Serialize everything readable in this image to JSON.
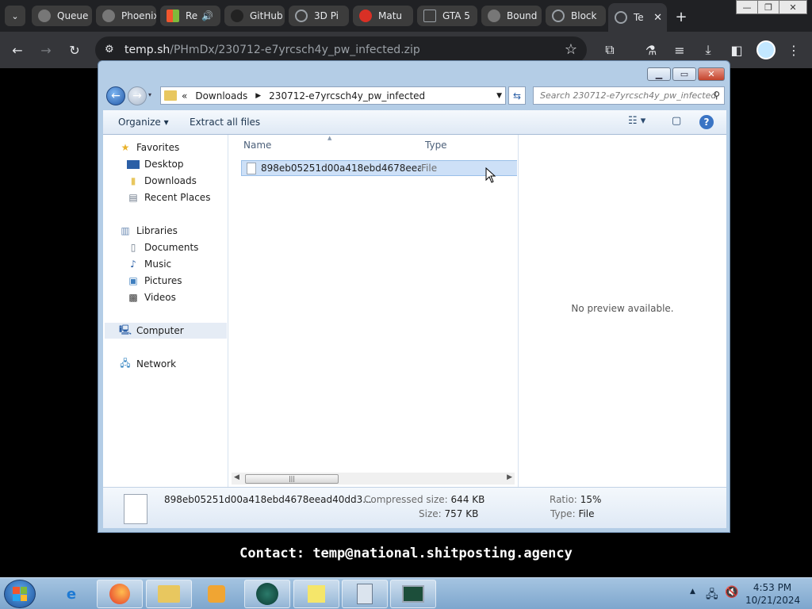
{
  "browser": {
    "tabs": [
      {
        "label": "Queue",
        "icon": "obs-icon",
        "color": "#777777"
      },
      {
        "label": "Phoenix",
        "icon": "obs-icon",
        "color": "#777777"
      },
      {
        "label": "Re",
        "icon": "windows-flag-icon",
        "color": "#f2572e",
        "audio": "speaker-icon"
      },
      {
        "label": "GitHub",
        "icon": "github-icon",
        "color": "#222222"
      },
      {
        "label": "3D Pi",
        "icon": "globe-icon",
        "color": "#9aa0a6"
      },
      {
        "label": "Matu",
        "icon": "red-logo-icon",
        "color": "#d93025"
      },
      {
        "label": "GTA 5",
        "icon": "gta-icon",
        "color": "#9aa0a6"
      },
      {
        "label": "Bound",
        "icon": "obs-icon",
        "color": "#777777"
      },
      {
        "label": "Block",
        "icon": "globe-icon",
        "color": "#9aa0a6"
      },
      {
        "label": "Te",
        "icon": "globe-icon",
        "color": "#9aa0a6",
        "active": true
      }
    ],
    "url_host": "temp.sh",
    "url_path": "/PHmDx/230712-e7yrcsch4y_pw_infected.zip"
  },
  "explorer": {
    "address": {
      "prefix": "«",
      "crumbs": [
        "Downloads",
        "230712-e7yrcsch4y_pw_infected"
      ]
    },
    "search_placeholder": "Search 230712-e7yrcsch4y_pw_infected",
    "commands": {
      "organize": "Organize",
      "extract": "Extract all files"
    },
    "nav": {
      "favorites": "Favorites",
      "desktop": "Desktop",
      "downloads": "Downloads",
      "recent": "Recent Places",
      "libraries": "Libraries",
      "documents": "Documents",
      "music": "Music",
      "pictures": "Pictures",
      "videos": "Videos",
      "computer": "Computer",
      "network": "Network"
    },
    "columns": {
      "name": "Name",
      "type": "Type"
    },
    "files": [
      {
        "name": "898eb05251d00a418ebd4678eead40...",
        "type": "File"
      }
    ],
    "preview_text": "No preview available.",
    "details": {
      "filename": "898eb05251d00a418ebd4678eead40dd3...",
      "compressed_label": "Compressed size:",
      "compressed_value": "644 KB",
      "size_label": "Size:",
      "size_value": "757 KB",
      "ratio_label": "Ratio:",
      "ratio_value": "15%",
      "type_label": "Type:",
      "type_value": "File"
    }
  },
  "page_text": {
    "contact_label": "Contact:",
    "contact_email": "temp@national.shitposting.agency"
  },
  "taskbar": {
    "time": "4:53 PM",
    "date": "10/21/2024"
  }
}
